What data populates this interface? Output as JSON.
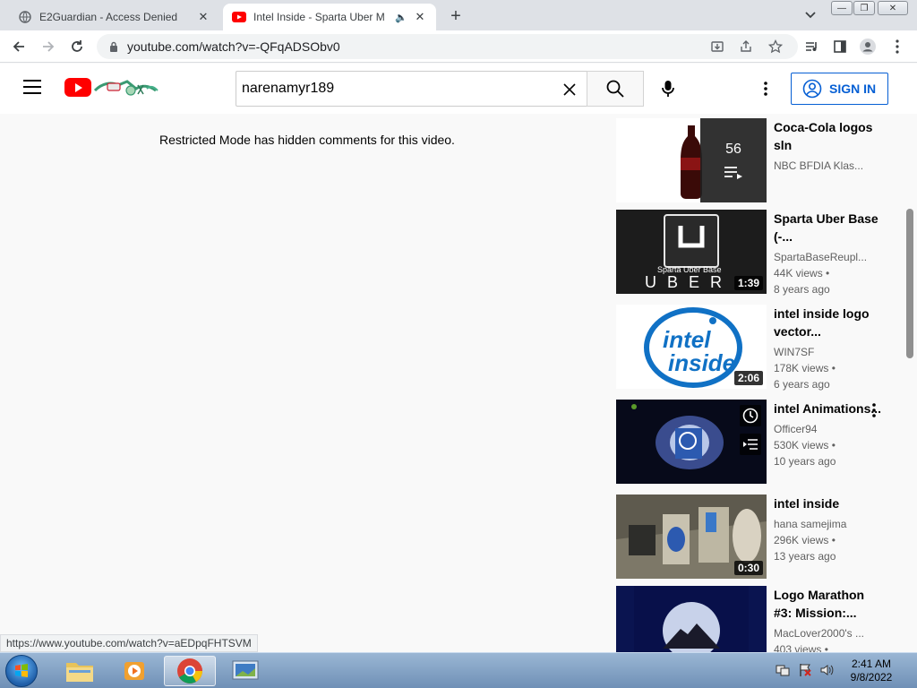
{
  "browser": {
    "tabs": [
      {
        "title": "E2Guardian - Access Denied",
        "active": false
      },
      {
        "title": "Intel Inside - Sparta Uber M",
        "active": true
      }
    ],
    "url": "youtube.com/watch?v=-QFqADSObv0"
  },
  "youtube": {
    "search_query": "narenamyr189",
    "signin_label": "SIGN IN",
    "restricted_text": "Restricted Mode has hidden comments for this video."
  },
  "recommendations": [
    {
      "title": "Coca-Cola logos sln",
      "channel": "NBC BFDIA Klas...",
      "views": "",
      "age": "",
      "playlist_count": "56",
      "duration": ""
    },
    {
      "title": "Sparta Uber Base (-...",
      "channel": "SpartaBaseReupl...",
      "views": "44K views •",
      "age": "8 years ago",
      "duration": "1:39",
      "thumb_text": "Sparta Uber Base",
      "thumb_brand": "UBER"
    },
    {
      "title": "intel inside logo vector...",
      "channel": "WIN7SF",
      "views": "178K views •",
      "age": "6 years ago",
      "duration": "2:06"
    },
    {
      "title": "intel Animations...",
      "channel": "Officer94",
      "views": "530K views •",
      "age": "10 years ago",
      "duration": ""
    },
    {
      "title": "intel inside",
      "channel": "hana samejima",
      "views": "296K views •",
      "age": "13 years ago",
      "duration": "0:30"
    },
    {
      "title": "Logo Marathon #3: Mission:...",
      "channel": "MacLover2000's ...",
      "views": "403 views •",
      "age": "",
      "duration": ""
    }
  ],
  "status_url": "https://www.youtube.com/watch?v=aEDpqFHTSVM",
  "taskbar": {
    "time": "2:41 AM",
    "date": "9/8/2022"
  },
  "colors": {
    "yt_red": "#ff0000",
    "signin_blue": "#065fd4",
    "taskbar": "#7f9fc3"
  }
}
